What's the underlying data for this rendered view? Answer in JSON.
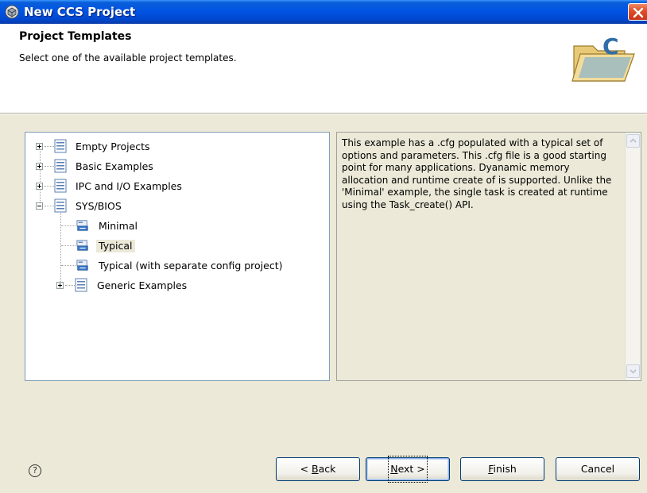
{
  "window": {
    "title": "New CCS Project"
  },
  "header": {
    "title": "Project Templates",
    "description": "Select one of the available project templates."
  },
  "tree": {
    "items": [
      {
        "label": "Empty Projects"
      },
      {
        "label": "Basic Examples"
      },
      {
        "label": "IPC and I/O Examples"
      },
      {
        "label": "SYS/BIOS"
      },
      {
        "label": "Minimal"
      },
      {
        "label": "Typical"
      },
      {
        "label": "Typical (with separate config project)"
      },
      {
        "label": "Generic Examples"
      }
    ],
    "selected": "Typical"
  },
  "details": {
    "text": "This example has a .cfg populated with a typical set of options and parameters.  This .cfg file is a good starting point for many applications. Dyanamic memory allocation and runtime create of is supported.  Unlike the 'Minimal' example, the single task is created at runtime using the Task_create() API."
  },
  "footer": {
    "help_symbol": "?",
    "back": {
      "before": "< ",
      "mnemonic": "B",
      "after": "ack"
    },
    "next": {
      "before": "",
      "mnemonic": "N",
      "after": "ext >"
    },
    "finish": {
      "before": "",
      "mnemonic": "F",
      "after": "inish"
    },
    "cancel": "Cancel"
  },
  "icons": {
    "app": "ccs-app-icon",
    "close": "close-icon",
    "folder": "folder-c-icon",
    "template_group": "template-group-icon",
    "template": "template-icon"
  },
  "colors": {
    "titlebar": "#0054e3",
    "dialog_bg": "#ece9d8",
    "close": "#e0502a",
    "button_border": "#003c74"
  }
}
